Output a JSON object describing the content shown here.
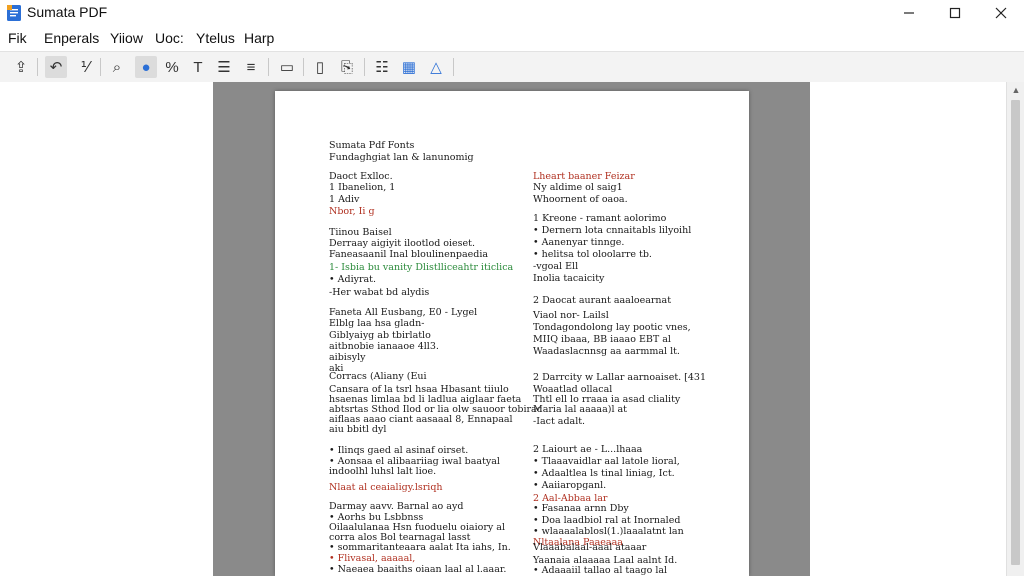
{
  "window": {
    "title": "Sumata PDF"
  },
  "menu": [
    "Fik",
    "Enperals",
    "Yiiow",
    "Uoc:",
    "Ytelus",
    "Harp"
  ],
  "toolbar": {
    "buttons": [
      {
        "name": "open-button",
        "glyph": "⇪"
      },
      {
        "name": "undo-button",
        "glyph": "↶"
      },
      {
        "name": "tool-button",
        "glyph": "⅟"
      },
      {
        "name": "find-button",
        "glyph": "⌕"
      },
      {
        "name": "globe-button",
        "glyph": "●"
      },
      {
        "name": "percent-button",
        "glyph": "%"
      },
      {
        "name": "text-button",
        "glyph": "T"
      },
      {
        "name": "list-button",
        "glyph": "☰"
      },
      {
        "name": "align-button",
        "glyph": "≡"
      },
      {
        "name": "comment-button",
        "glyph": "▭"
      },
      {
        "name": "page-button",
        "glyph": "▯"
      },
      {
        "name": "bookmark-button",
        "glyph": "⎘"
      },
      {
        "name": "outline-button",
        "glyph": "☷"
      },
      {
        "name": "layout-button",
        "glyph": "▦"
      },
      {
        "name": "highlight-button",
        "glyph": "△"
      }
    ]
  },
  "document": {
    "left_lines": [
      {
        "text": "Sumata Pdf Fonts",
        "style": ""
      },
      {
        "text": "Fundaghgiat lan & lanunomig",
        "style": ""
      },
      {
        "text": "Daoct Exlloc.",
        "style": ""
      },
      {
        "text": "1 Ibanelion, 1",
        "style": ""
      },
      {
        "text": "1   Adiv",
        "style": ""
      },
      {
        "text": "     Nbor, Ii g",
        "style": "red"
      },
      {
        "text": "        Tiinou Baisel",
        "style": ""
      },
      {
        "text": "Derraay aigiyit ilootlod oieset.",
        "style": ""
      },
      {
        "text": "Faneasaanil Inal bloulinenpaedia",
        "style": ""
      },
      {
        "text": "1-   Isbia bu vanity Dlistlliceahtr iticlica",
        "style": "green"
      },
      {
        "text": "   •   Adiyrat.",
        "style": ""
      },
      {
        "text": "      -Her wabat bd alydis",
        "style": ""
      },
      {
        "text": "Faneta All Eusbang, E0 - Lygel",
        "style": ""
      },
      {
        "text": "Elblg laa hsa gladn-",
        "style": ""
      },
      {
        "text": "Giblyaiyg ab tbirlatlo",
        "style": ""
      },
      {
        "text": "aitbnobie ianaaoe 4ll3.",
        "style": ""
      },
      {
        "text": "aibisyly",
        "style": ""
      },
      {
        "text": "aki",
        "style": ""
      },
      {
        "text": "Corracs (Aliany (Eui",
        "style": ""
      },
      {
        "text": "Cansara of la tsrl hsaa Hbasant tiiulo",
        "style": ""
      },
      {
        "text": "hsaenas limlaa bd li ladlua aiglaar faeta",
        "style": ""
      },
      {
        "text": "abtsrtas Sthod Ilod or lia olw sauoor tobirac",
        "style": ""
      },
      {
        "text": "aiflaas aaao ciant aasaaal 8, Ennapaal",
        "style": ""
      },
      {
        "text": "aiu bbitl dyl",
        "style": ""
      },
      {
        "text": "   •   Ilinqs gaed al asinaf oirset.",
        "style": ""
      },
      {
        "text": "   •   Aonsaa el alibaariiag iwal baatyal",
        "style": ""
      },
      {
        "text": "       indoolhl luhsl lalt lioe.",
        "style": ""
      },
      {
        "text": "       Nlaat al ceaialigy.lsriqh",
        "style": "red"
      },
      {
        "text": "Darmay aavv.  Barnal ao ayd",
        "style": ""
      },
      {
        "text": "   •   Aorhs bu Lsbbnss",
        "style": ""
      },
      {
        "text": "       Oilaalulanaa Hsn fuoduelu oiaiory al",
        "style": ""
      },
      {
        "text": "       corra alos Bol tearnagal lasst",
        "style": ""
      },
      {
        "text": "   •   sommaritanteaara aalat Ita iahs, In.",
        "style": ""
      },
      {
        "text": "   •   Flivasal, aaaaal,",
        "style": "red"
      },
      {
        "text": "   •   Naeaea baaiths oiaan laal al l.aaar.",
        "style": ""
      }
    ],
    "right_lines": [
      {
        "text": "Lheart baaner Feizar",
        "style": "red"
      },
      {
        "text": "  Ny aldime ol saig1",
        "style": ""
      },
      {
        "text": "  Whoornent of oaoa.",
        "style": ""
      },
      {
        "text": "1    Kreone - ramant aolorimo",
        "style": ""
      },
      {
        "text": "      •   Dernern lota cnnaitabls lilyoihl",
        "style": ""
      },
      {
        "text": "      •   Aanenyar tinnge.",
        "style": ""
      },
      {
        "text": "      •   helitsa tol oloolarre tb.",
        "style": ""
      },
      {
        "text": "      -vgoal Ell",
        "style": ""
      },
      {
        "text": "      Inolia tacaicity",
        "style": ""
      },
      {
        "text": "2    Daocat aurant aaaloearnat",
        "style": ""
      },
      {
        "text": "Viaol nor- Lailsl",
        "style": ""
      },
      {
        "text": "Tondagondolong lay pootic vnes,",
        "style": ""
      },
      {
        "text": "MIIQ ibaaa, BB iaaao EBT al",
        "style": ""
      },
      {
        "text": "Waadaslacnnsg aa aarmmal lt.",
        "style": ""
      },
      {
        "text": "2    Darrcity w Lallar aarnoaiset. [431",
        "style": ""
      },
      {
        "text": "  Woaatlad ollacal",
        "style": ""
      },
      {
        "text": "  Thtl ell lo rraaa ia asad cliality",
        "style": ""
      },
      {
        "text": "  Maria lal aaaaa)l at",
        "style": ""
      },
      {
        "text": "  -Iact adalt.",
        "style": ""
      },
      {
        "text": "2    Laiourt ae - L...lhaaa",
        "style": ""
      },
      {
        "text": "      •   Tlaaavaidlar aal latole lioral,",
        "style": ""
      },
      {
        "text": "      •   Adaaltlea ls tinal liniag, Ict.",
        "style": ""
      },
      {
        "text": "      •   Aaiiaropganl.",
        "style": ""
      },
      {
        "text": "2    Aal-Abbaa lar",
        "style": "red"
      },
      {
        "text": "      •   Fasanaa arnn Dby",
        "style": ""
      },
      {
        "text": "      •   Doa laadbiol ral at Inornaled",
        "style": ""
      },
      {
        "text": "      •   wlaaaalablosl(1.)laaalatnt lan",
        "style": ""
      },
      {
        "text": "          Nltaalana Paaeaaa",
        "style": "red"
      },
      {
        "text": "Vlaaabalaal-aaal ataaar",
        "style": ""
      },
      {
        "text": "  Yaanaia alaaaaa Laal aalnt Id.",
        "style": ""
      },
      {
        "text": "  •   Adaaaiil tallao al taago lal",
        "style": ""
      }
    ]
  }
}
